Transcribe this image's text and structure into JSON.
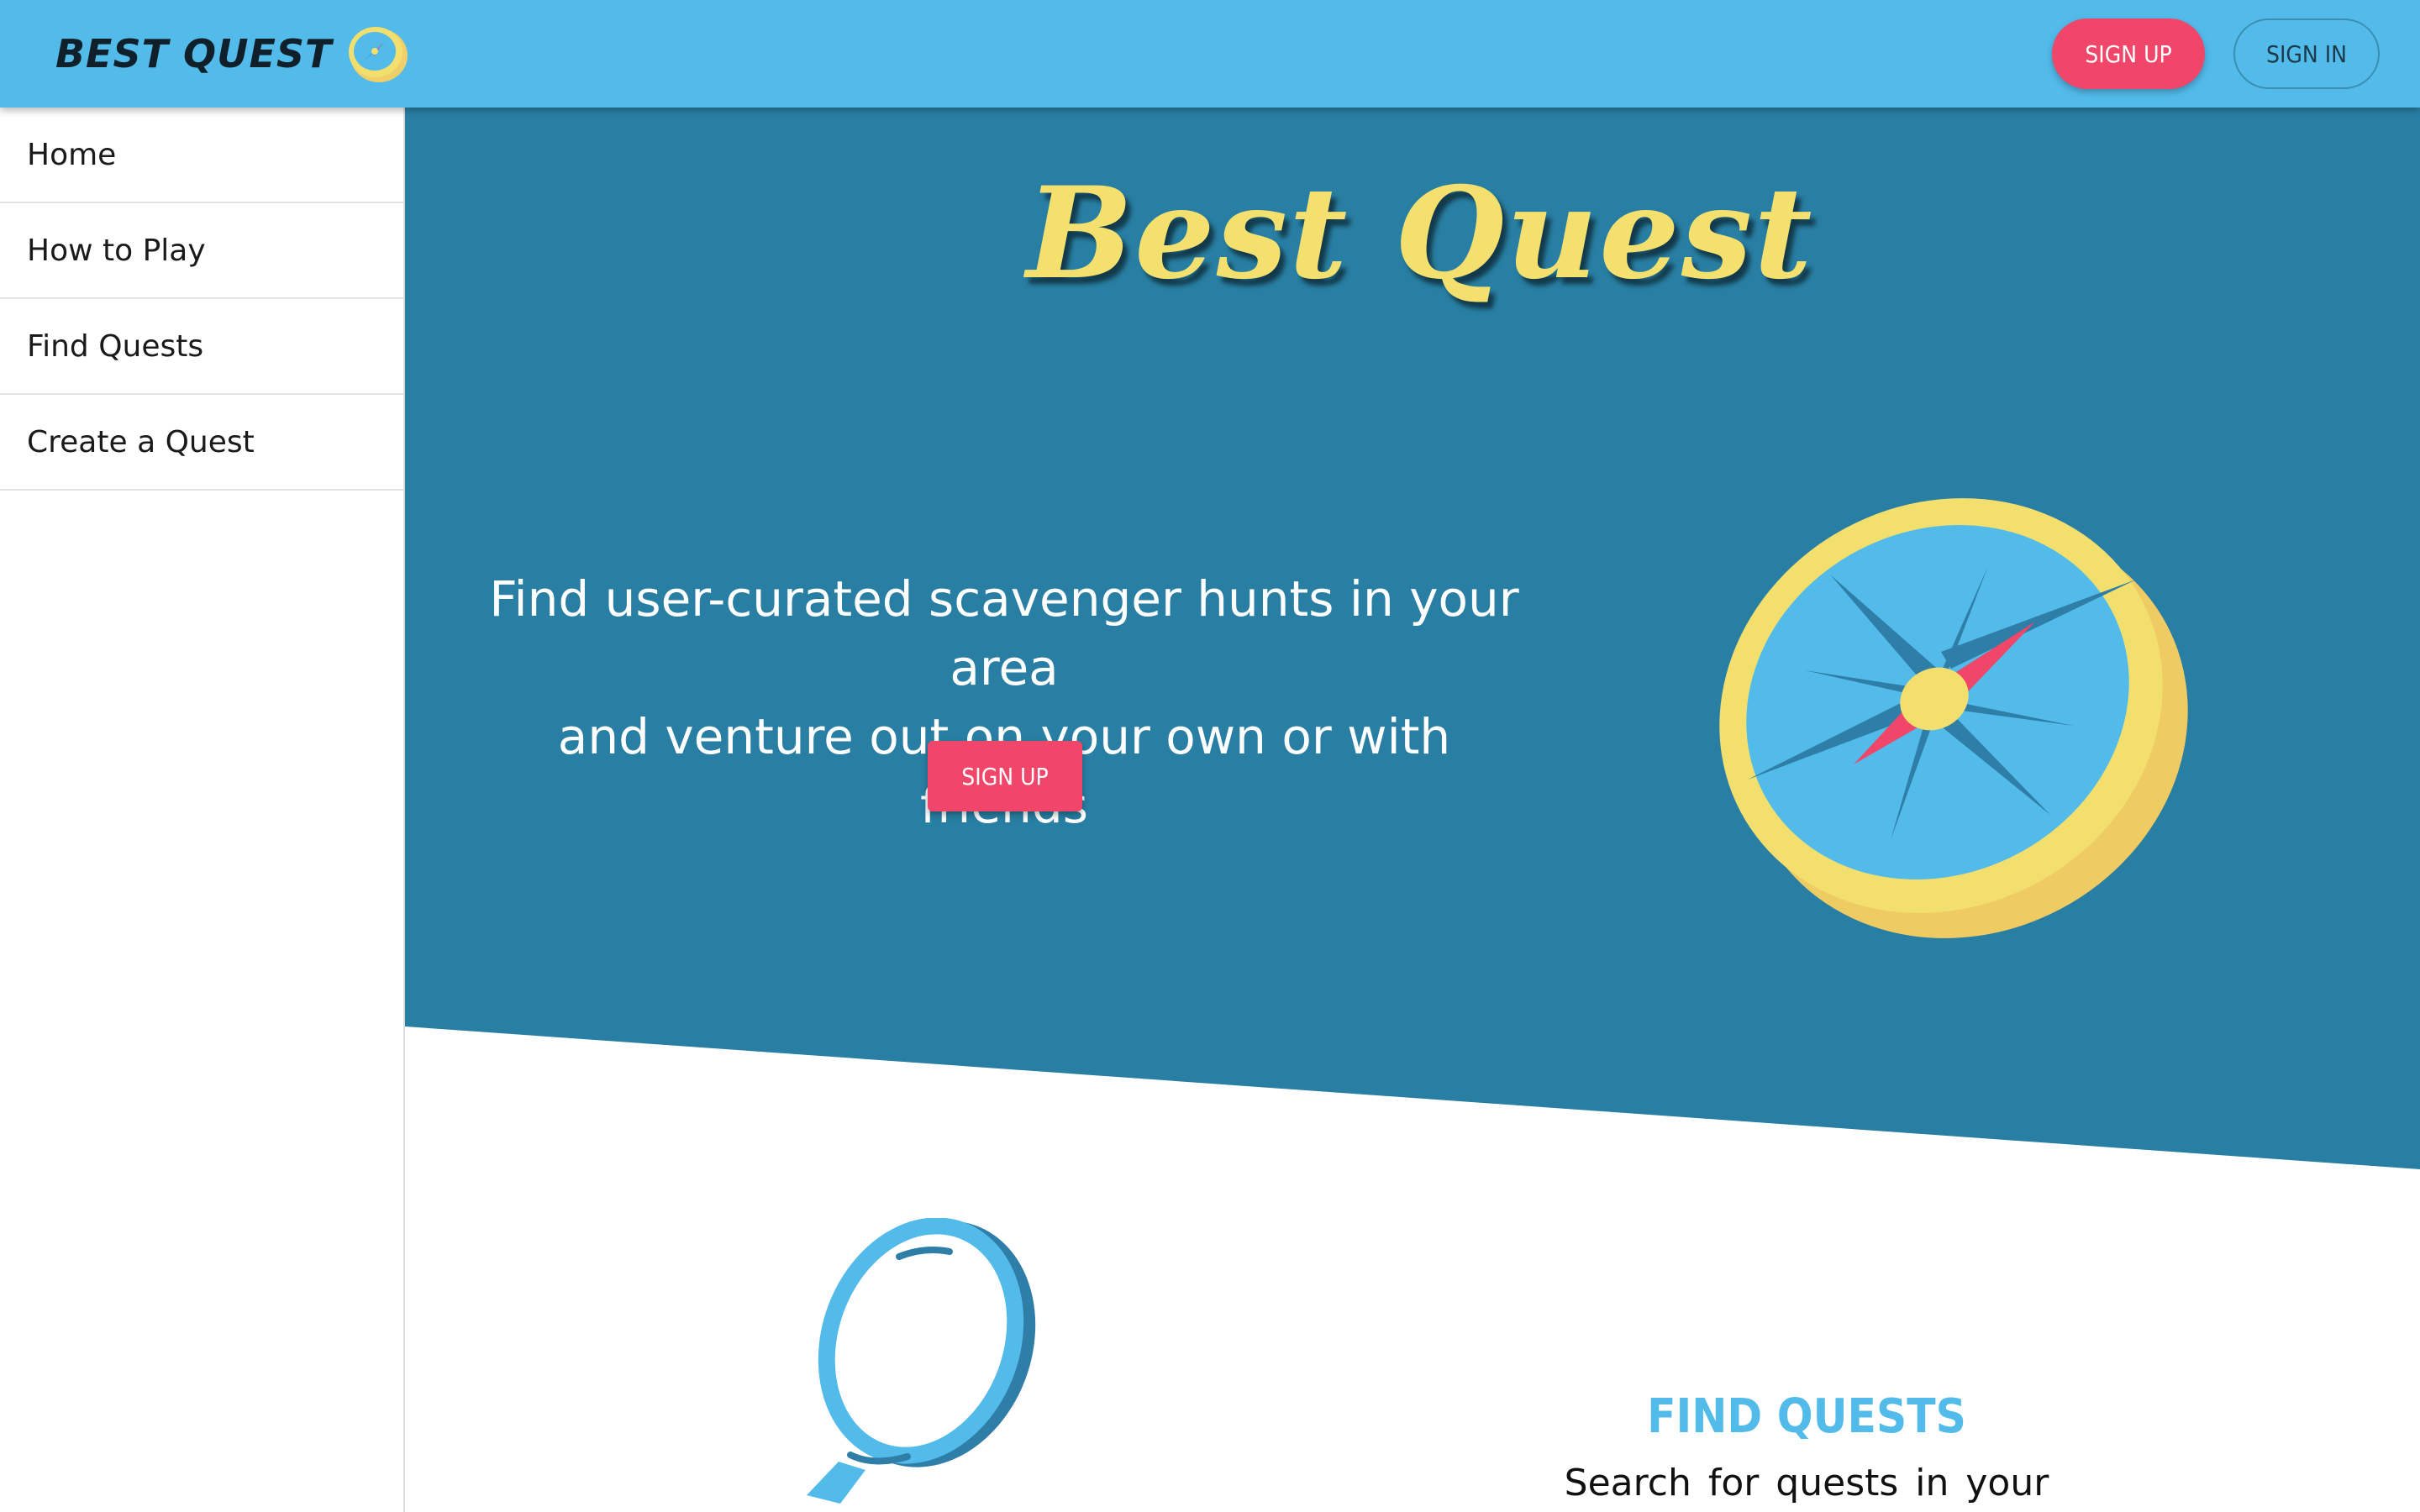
{
  "header": {
    "brand": "BEST QUEST",
    "brand_icon": "compass-icon",
    "signup_label": "SIGN UP",
    "signin_label": "SIGN IN"
  },
  "sidebar": {
    "items": [
      {
        "label": "Home"
      },
      {
        "label": "How to Play"
      },
      {
        "label": "Find Quests"
      },
      {
        "label": "Create a Quest"
      }
    ]
  },
  "hero": {
    "title": "Best Quest",
    "tagline_line1": "Find user-curated scavenger hunts in your area",
    "tagline_line2": "and venture out on your own or with friends",
    "signup_label": "SIGN UP",
    "illustration_icon": "compass-icon"
  },
  "feature": {
    "icon": "magnifying-glass-icon",
    "title": "FIND QUESTS",
    "description": "Search for quests in your area."
  },
  "colors": {
    "header_bg": "#52bbea",
    "hero_bg": "#287fa3",
    "accent": "#f0466a",
    "title_yellow": "#f4e06e",
    "feature_title": "#52bbea"
  }
}
